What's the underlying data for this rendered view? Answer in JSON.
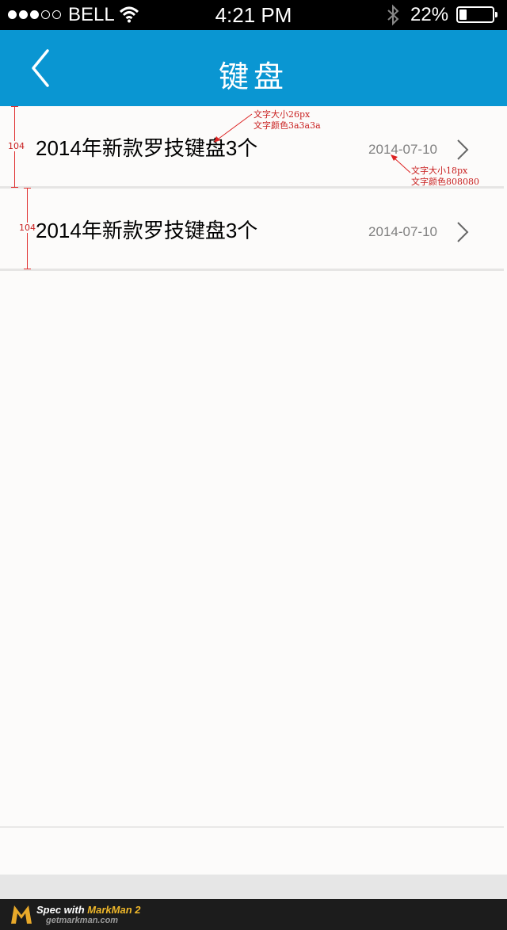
{
  "status_bar": {
    "carrier": "BELL",
    "time": "4:21 PM",
    "battery": "22%",
    "battery_level": 0.22,
    "signal_filled": 3,
    "signal_total": 5
  },
  "nav": {
    "title": "键盘",
    "back_icon": "chevron-left-icon",
    "background": "#0a96d2"
  },
  "list": {
    "items": [
      {
        "title": "2014年新款罗技键盘3个",
        "date": "2014-07-10"
      },
      {
        "title": "2014年新款罗技键盘3个",
        "date": "2014-07-10"
      }
    ]
  },
  "annotations": {
    "title_spec_line1": "文字大小26px",
    "title_spec_line2": "文字颜色3a3a3a",
    "date_spec_line1": "文字大小18px",
    "date_spec_line2": "文字颜色808080",
    "row_height_1": "104",
    "row_height_2": "104"
  },
  "markman": {
    "spec_prefix": "Spec with ",
    "brand": "MarkMan 2",
    "url": "getmarkman.com"
  },
  "colors": {
    "title_text": "#3a3a3a",
    "date_text": "#808080",
    "annotation": "#c81e1e"
  }
}
